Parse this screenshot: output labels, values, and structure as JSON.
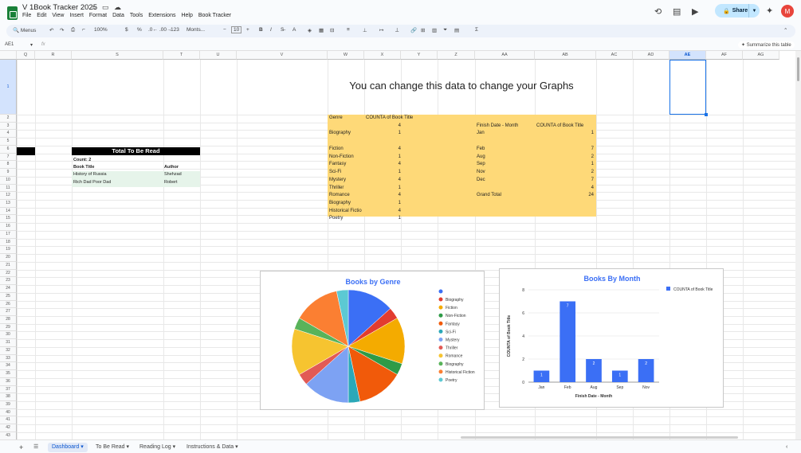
{
  "app": {
    "doc_title": "V 1Book Tracker 2025",
    "menu": [
      "File",
      "Edit",
      "View",
      "Insert",
      "Format",
      "Data",
      "Tools",
      "Extensions",
      "Help",
      "Book Tracker"
    ],
    "share_label": "Share",
    "avatar_initial": "M"
  },
  "toolbar": {
    "search_label": "Menus",
    "zoom": "100%",
    "currency": "$",
    "percent": "%",
    "dec_less": ".0←",
    "dec_more": ".00→",
    "number_format": "123",
    "font": "Monts...",
    "font_size": "10",
    "bold": "B",
    "italic": "I"
  },
  "formula_bar": {
    "cell_ref": "AE1",
    "fx": "fx",
    "summarize": "Summarize this table"
  },
  "columns": [
    "Q",
    "R",
    "S",
    "T",
    "U",
    "V",
    "W",
    "X",
    "Y",
    "Z",
    "AA",
    "AB",
    "AC",
    "AD",
    "AE",
    "AF",
    "AG"
  ],
  "rows": [
    "1",
    "2",
    "3",
    "4",
    "5",
    "6",
    "7",
    "8",
    "9",
    "10",
    "11",
    "12",
    "13",
    "14",
    "15",
    "16",
    "17",
    "18",
    "19",
    "20",
    "21",
    "22",
    "23",
    "24",
    "25",
    "26",
    "27",
    "28",
    "29",
    "30",
    "31",
    "32",
    "33",
    "34",
    "35",
    "36",
    "37",
    "38",
    "39",
    "40",
    "41",
    "42",
    "43"
  ],
  "banner": "You can change this data to change your Graphs",
  "to_be_read": {
    "title": "Total To Be Read",
    "count": "Count: 2",
    "col1": "Book Title",
    "col2": "Author",
    "rows": [
      {
        "title": "History of Russia",
        "author": "Shehzad"
      },
      {
        "title": "Rich Dad Poor Dad",
        "author": "Robert"
      }
    ]
  },
  "genre_table": {
    "h1": "Genre",
    "h2": "COUNTA of Book Title",
    "first_count": "4",
    "rows": [
      {
        "g": "Biography",
        "c": "1"
      },
      {
        "g": "",
        "c": ""
      },
      {
        "g": "Fiction",
        "c": "4"
      },
      {
        "g": "Non-Fiction",
        "c": "1"
      },
      {
        "g": "Fantasy",
        "c": "4"
      },
      {
        "g": "Sci-Fi",
        "c": "1"
      },
      {
        "g": "Mystery",
        "c": "4"
      },
      {
        "g": "Thriller",
        "c": "1"
      },
      {
        "g": "Romance",
        "c": "4"
      },
      {
        "g": "Biography",
        "c": "1"
      },
      {
        "g": "Historical Fictio",
        "c": "4"
      },
      {
        "g": "Poetry",
        "c": "1"
      }
    ]
  },
  "month_table": {
    "h1": "Finish Date - Month",
    "h2": "COUNTA of Book Title",
    "rows": [
      {
        "m": "Jan",
        "c": "1"
      },
      {
        "m": "",
        "c": ""
      },
      {
        "m": "Feb",
        "c": "7"
      },
      {
        "m": "Aug",
        "c": "2"
      },
      {
        "m": "Sep",
        "c": "1"
      },
      {
        "m": "Nov",
        "c": "2"
      },
      {
        "m": "Dec",
        "c": "7"
      },
      {
        "m": "",
        "c": "4"
      },
      {
        "m": "Grand Total",
        "c": "24"
      }
    ]
  },
  "chart_data": [
    {
      "type": "pie",
      "title": "Books by Genre",
      "legend_position": "right",
      "labels": [
        "Biography",
        "Fiction",
        "Non-Fiction",
        "Fantasy",
        "Sci-Fi",
        "Mystery",
        "Thriller",
        "Romance",
        "Biography",
        "Historical Fiction",
        "Poetry"
      ],
      "values": [
        1,
        4,
        1,
        4,
        1,
        4,
        1,
        4,
        1,
        4,
        1
      ],
      "colors": [
        "#3b6ff5",
        "#e23c2f",
        "#f4ab00",
        "#2e9b47",
        "#f15a0a",
        "#2aa8b8",
        "#7da2f3",
        "#e25a55",
        "#f6c430",
        "#59b35a",
        "#fb7f32",
        "#5cc9d3"
      ],
      "first_slice": {
        "label": "(blank)",
        "value": 4
      }
    },
    {
      "type": "bar",
      "title": "Books By Month",
      "legend": "COUNTA of Book Title",
      "legend_position": "top-right",
      "categories": [
        "Jan",
        "Feb",
        "Aug",
        "Sep",
        "Nov"
      ],
      "values": [
        1,
        7,
        2,
        1,
        2
      ],
      "xlabel": "Finish Date - Month",
      "ylabel": "COUNTA of Book Title",
      "ylim": [
        0,
        8
      ],
      "yticks": [
        "0",
        "2",
        "4",
        "6",
        "8"
      ],
      "color": "#3b6ff5"
    }
  ],
  "sheets": [
    "Dashboard",
    "To Be Read",
    "Reading Log",
    "Instructions & Data"
  ]
}
